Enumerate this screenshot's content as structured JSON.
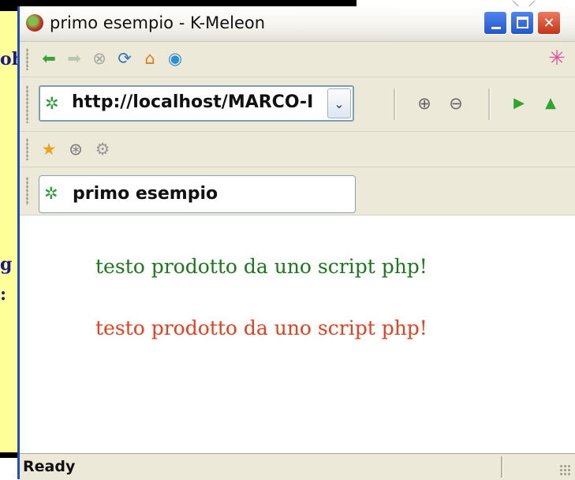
{
  "window": {
    "title": "primo esempio - K-Meleon",
    "buttons": {
      "minimize": "minimize",
      "maximize": "maximize",
      "close": "close"
    }
  },
  "background": {
    "fragments": [
      "oh",
      "g",
      ":"
    ]
  },
  "nav_toolbar": {
    "icons": [
      "back-icon",
      "forward-icon",
      "stop-icon",
      "reload-icon",
      "home-icon",
      "go-icon",
      "throbber-icon"
    ]
  },
  "address_bar": {
    "url": "http://localhost/MARCO-I",
    "dropdown_glyph": "⌄",
    "icons": [
      "zoom-in-icon",
      "zoom-out-icon",
      "go-arrow-icon",
      "up-arrow-icon"
    ]
  },
  "bookmarks_toolbar": {
    "icons": [
      "star-icon",
      "history-icon",
      "gear-icon"
    ]
  },
  "tab": {
    "label": "primo esempio"
  },
  "content": {
    "lines": [
      {
        "text": "testo prodotto da uno script php!",
        "color": "#1a7a1a"
      },
      {
        "text": "testo prodotto da uno script php!",
        "color": "#ee3d1a"
      }
    ]
  },
  "status": {
    "text": "Ready"
  },
  "colors": {
    "slide_bg": "#ffff99",
    "window_chrome": "#ece9d8",
    "xp_blue": "#2457c9",
    "close_red": "#c4331a"
  }
}
